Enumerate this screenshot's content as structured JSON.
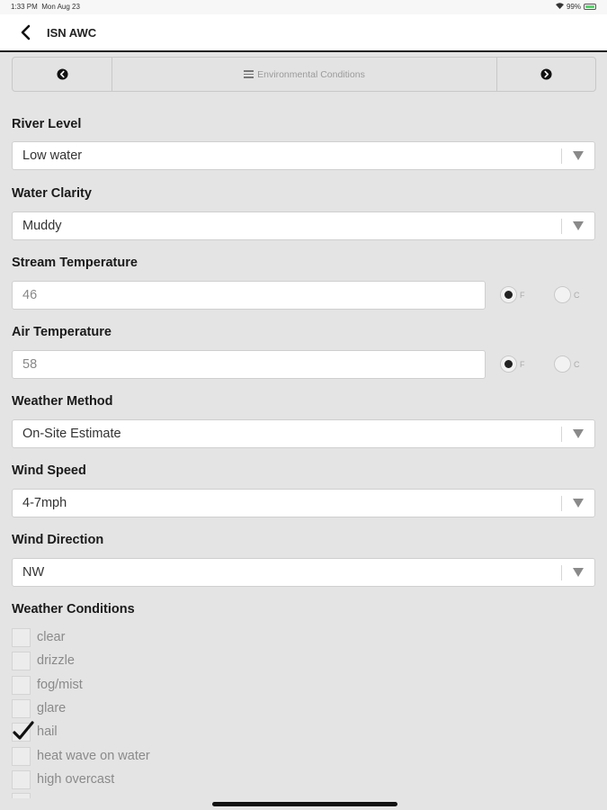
{
  "status_bar": {
    "time": "1:33 PM",
    "date": "Mon Aug 23",
    "battery": "99%"
  },
  "nav": {
    "title": "ISN AWC"
  },
  "section_nav": {
    "title": "Environmental Conditions"
  },
  "fields": {
    "river_level": {
      "label": "River Level",
      "value": "Low water"
    },
    "water_clarity": {
      "label": "Water Clarity",
      "value": "Muddy"
    },
    "stream_temperature": {
      "label": "Stream Temperature",
      "value": "46",
      "unit_f": "F",
      "unit_c": "C",
      "selected_unit": "F"
    },
    "air_temperature": {
      "label": "Air Temperature",
      "value": "58",
      "unit_f": "F",
      "unit_c": "C",
      "selected_unit": "F"
    },
    "weather_method": {
      "label": "Weather Method",
      "value": "On-Site Estimate"
    },
    "wind_speed": {
      "label": "Wind Speed",
      "value": "4-7mph"
    },
    "wind_direction": {
      "label": "Wind Direction",
      "value": "NW"
    }
  },
  "weather_conditions": {
    "label": "Weather Conditions",
    "options": [
      {
        "label": "clear",
        "checked": false
      },
      {
        "label": "drizzle",
        "checked": false
      },
      {
        "label": "fog/mist",
        "checked": false
      },
      {
        "label": "glare",
        "checked": false
      },
      {
        "label": "hail",
        "checked": true
      },
      {
        "label": "heat wave on water",
        "checked": false
      },
      {
        "label": "high overcast",
        "checked": false
      }
    ]
  }
}
